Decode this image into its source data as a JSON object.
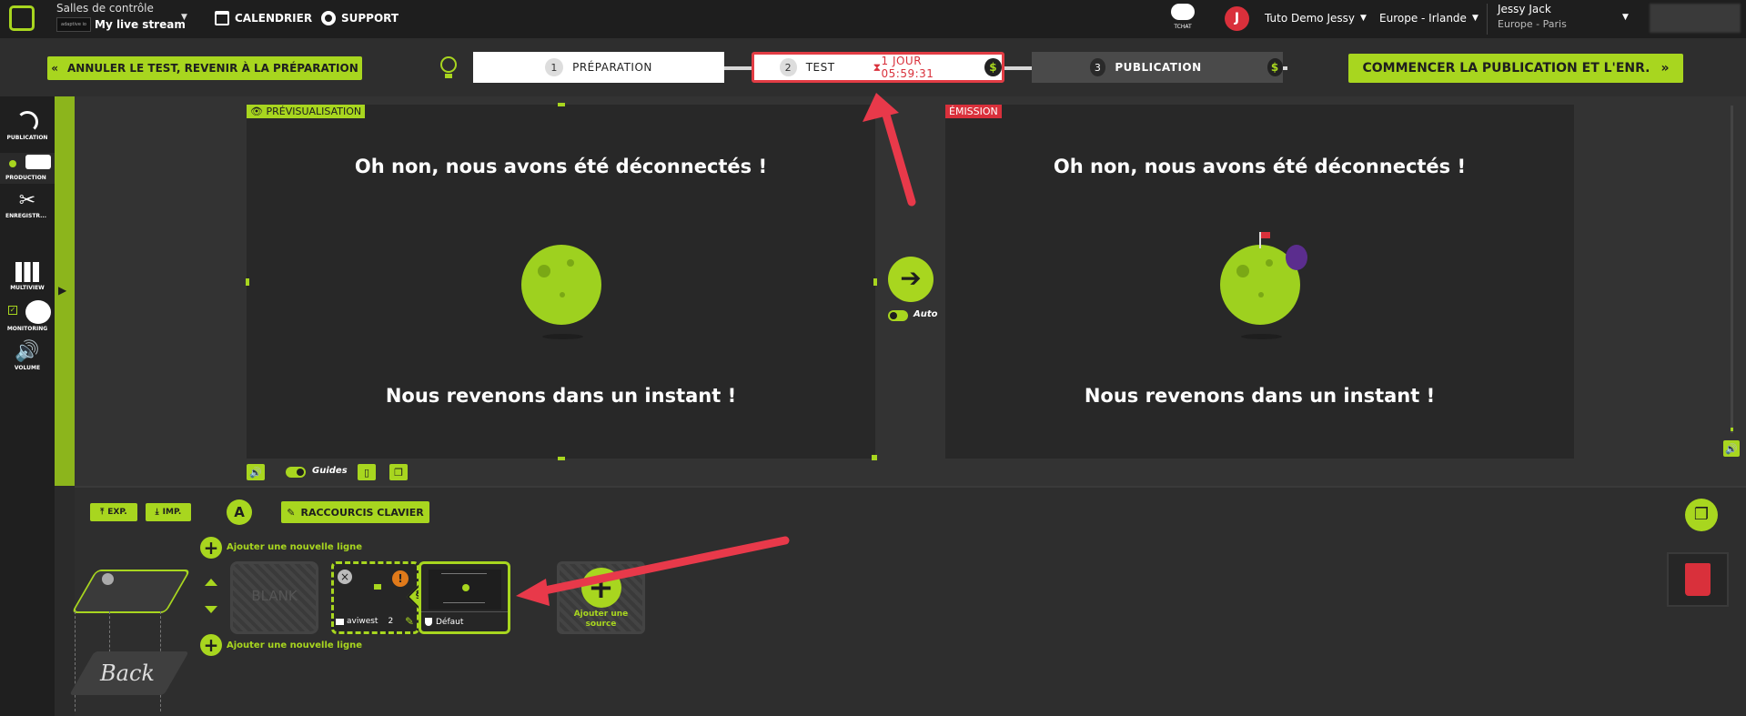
{
  "header": {
    "rooms_label": "Salles de contrôle",
    "logo_text": "adaptive io",
    "stream_name": "My live stream",
    "calendar": "CALENDRIER",
    "support": "SUPPORT",
    "chat": "TCHAT",
    "avatar_letter": "J",
    "org": "Tuto Demo Jessy",
    "region": "Europe - Irlande",
    "user_name": "Jessy Jack",
    "user_tz": "Europe - Paris"
  },
  "toolbar": {
    "cancel_test": "ANNULER LE TEST, REVENIR À LA PRÉPARATION",
    "start_publish": "COMMENCER LA PUBLICATION ET L'ENR.",
    "steps": [
      {
        "num": "1",
        "label": "PRÉPARATION"
      },
      {
        "num": "2",
        "label": "TEST",
        "timer": "1 JOUR 05:59:31"
      },
      {
        "num": "3",
        "label": "PUBLICATION"
      }
    ],
    "dollar": "$"
  },
  "sidebar": {
    "publication": "PUBLICATION",
    "production": "PRODUCTION",
    "enregistr": "ENREGISTR...",
    "multiview": "MULTIVIEW",
    "monitoring": "MONITORING",
    "volume": "VOLUME"
  },
  "preview": {
    "tag": "PRÉVISUALISATION",
    "line1": "Oh non, nous avons été déconnectés !",
    "line2": "Nous revenons dans un instant !",
    "guides": "Guides"
  },
  "program": {
    "tag": "ÉMISSION",
    "line1": "Oh non, nous avons été déconnectés !",
    "line2": "Nous revenons dans un instant !"
  },
  "transition": {
    "auto": "Auto"
  },
  "bottom": {
    "exp": "EXP.",
    "imp": "IMP.",
    "a_label": "A",
    "shortcuts": "RACCOURCIS CLAVIER",
    "add_line_top": "Ajouter une nouvelle ligne",
    "add_line_bottom": "Ajouter une nouvelle ligne",
    "back": "Back",
    "blank": "BLANK",
    "source_name": "aviwest",
    "source_count": "2",
    "default_label": "Défaut",
    "add_source": "Ajouter une source"
  },
  "colors": {
    "accent": "#a8d61f",
    "danger": "#d9303b",
    "dark": "#1e1e1e"
  }
}
